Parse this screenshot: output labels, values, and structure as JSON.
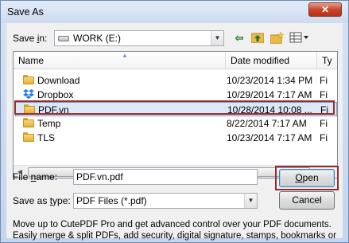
{
  "window": {
    "title": "Save As",
    "close_glyph": "✕"
  },
  "savein": {
    "label_prefix": "Save ",
    "label_mnemonic": "i",
    "label_suffix": "n:",
    "value": "WORK (E:)",
    "icons": [
      "back-arrow-icon",
      "up-folder-icon",
      "new-folder-icon",
      "views-menu-icon"
    ]
  },
  "columns": {
    "name": "Name",
    "date": "Date modified",
    "type": "Ty"
  },
  "files": [
    {
      "name": "Download",
      "date": "10/23/2014 1:34 PM",
      "type": "Fi",
      "icon": "folder-icon"
    },
    {
      "name": "Dropbox",
      "date": "10/29/2014 7:17 AM",
      "type": "Fi",
      "icon": "dropbox-icon"
    },
    {
      "name": "PDF.vn",
      "date": "10/28/2014 10:08 ...",
      "type": "Fi",
      "icon": "folder-icon",
      "selected": true
    },
    {
      "name": "Temp",
      "date": "8/22/2014 7:17 AM",
      "type": "Fi",
      "icon": "folder-icon"
    },
    {
      "name": "TLS",
      "date": "10/23/2014 7:17 AM",
      "type": "Fi",
      "icon": "folder-icon"
    }
  ],
  "filename": {
    "label_prefix": "File ",
    "label_mnemonic": "n",
    "label_suffix": "ame:",
    "value": "PDF.vn.pdf"
  },
  "savetype": {
    "label_prefix": "Save as ",
    "label_mnemonic": "t",
    "label_suffix": "ype:",
    "value": "PDF Files (*.pdf)"
  },
  "buttons": {
    "open_mnemonic": "O",
    "open_rest": "pen",
    "cancel": "Cancel"
  },
  "promo": {
    "line1": "Move up to CutePDF Pro and get advanced control over your PDF documents.",
    "line2": "Easily merge & split PDFs, add security, digital signature, stamps, bookmarks or"
  }
}
